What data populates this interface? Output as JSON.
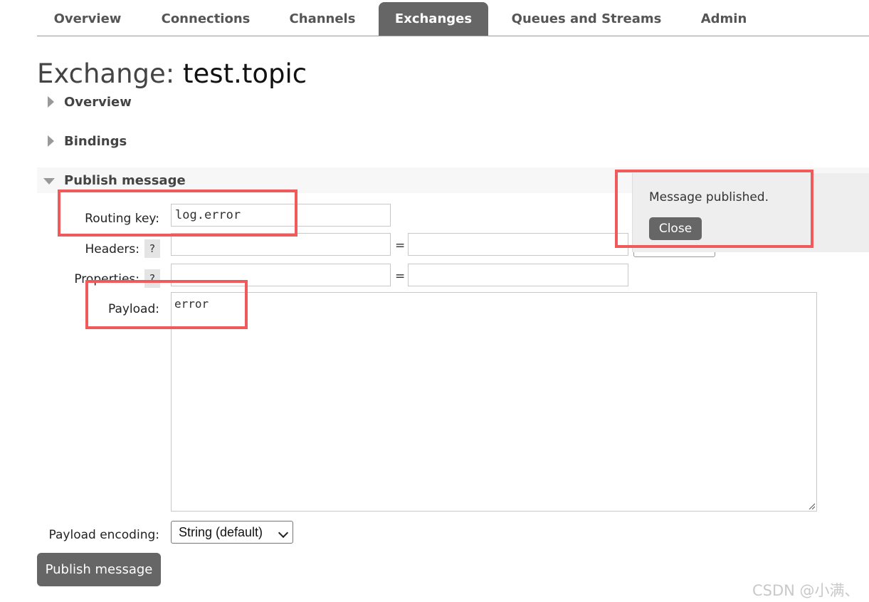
{
  "nav": {
    "tabs": [
      {
        "label": "Overview",
        "active": false
      },
      {
        "label": "Connections",
        "active": false
      },
      {
        "label": "Channels",
        "active": false
      },
      {
        "label": "Exchanges",
        "active": true
      },
      {
        "label": "Queues and Streams",
        "active": false
      },
      {
        "label": "Admin",
        "active": false
      }
    ]
  },
  "title": {
    "prefix": "Exchange:",
    "name": "test.topic"
  },
  "sections": {
    "overview": "Overview",
    "bindings": "Bindings",
    "publish": "Publish message"
  },
  "form": {
    "routing_key_label": "Routing key:",
    "routing_key_value": "log.error",
    "headers_label": "Headers:",
    "properties_label": "Properties:",
    "help": "?",
    "equals": "=",
    "payload_label": "Payload:",
    "payload_value": "error",
    "encoding_label": "Payload encoding:",
    "encoding_value": "String (default)",
    "publish_button": "Publish message"
  },
  "popup": {
    "message": "Message published.",
    "close_label": "Close"
  },
  "watermark": "CSDN @小满、",
  "colors": {
    "active_tab": "#666666",
    "highlight": "#f05a5a",
    "button": "#666666"
  }
}
